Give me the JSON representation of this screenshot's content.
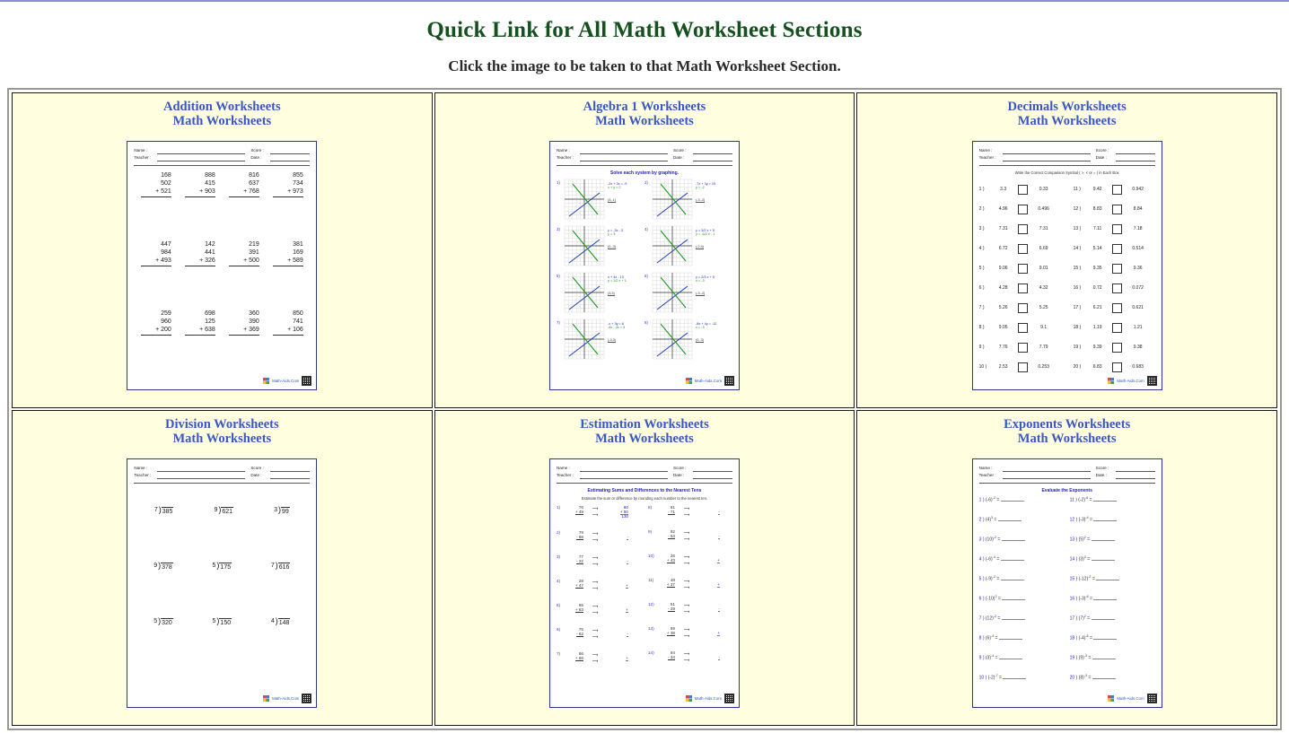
{
  "page": {
    "title": "Quick Link for All Math Worksheet Sections",
    "subtitle": "Click the image to be taken to that Math Worksheet Section.",
    "title_color": "#15501f",
    "link_color": "#3a57c4",
    "cell_bg": "#ffffe0"
  },
  "worksheet_header": {
    "name_label": "Name :",
    "teacher_label": "Teacher :",
    "score_label": "Score :",
    "date_label": "Date :"
  },
  "footer": {
    "logo": "math-aids-logo",
    "text": "Math-Aids.Com",
    "qr": "qr-code"
  },
  "cells": [
    {
      "id": "addition",
      "title_line1": "Addition Worksheets",
      "title_line2": "Math Worksheets",
      "sheet_type": "addition",
      "instruction": "",
      "rows": [
        [
          {
            "a": "168",
            "b": "502",
            "c": "+ 521"
          },
          {
            "a": "888",
            "b": "415",
            "c": "+ 903"
          },
          {
            "a": "816",
            "b": "637",
            "c": "+ 768"
          },
          {
            "a": "855",
            "b": "734",
            "c": "+ 973"
          }
        ],
        [
          {
            "a": "447",
            "b": "984",
            "c": "+ 493"
          },
          {
            "a": "142",
            "b": "441",
            "c": "+ 326"
          },
          {
            "a": "219",
            "b": "391",
            "c": "+ 500"
          },
          {
            "a": "381",
            "b": "169",
            "c": "+ 589"
          }
        ],
        [
          {
            "a": "259",
            "b": "960",
            "c": "+ 200"
          },
          {
            "a": "698",
            "b": "125",
            "c": "+ 638"
          },
          {
            "a": "360",
            "b": "390",
            "c": "+ 369"
          },
          {
            "a": "850",
            "b": "741",
            "c": "+ 106"
          }
        ]
      ]
    },
    {
      "id": "algebra-1",
      "title_line1": "Algebra 1 Worksheets",
      "title_line2": "Math Worksheets",
      "sheet_type": "algebra",
      "instruction": "Solve each system by graphing.",
      "problems": [
        {
          "no": "1)",
          "eq1": "-2x + 3x = -9",
          "eq2": "x + y = 2",
          "ans": "(3,-1)"
        },
        {
          "no": "2)",
          "eq1": "-7x + 3y = 15",
          "eq2": "y = -2",
          "ans": "(-3,-2)"
        },
        {
          "no": "3)",
          "eq1": "y = -3x - 3",
          "eq2": "y = 3",
          "ans": "(0,-3)"
        },
        {
          "no": "4)",
          "eq1": "y = 3/2 x + 5",
          "eq2": "y = -5/2 x - 1",
          "ans": "(-2,4)"
        },
        {
          "no": "5)",
          "eq1": "x + 4x - 13",
          "eq2": "y = 1/2 x + 1",
          "ans": "(3,3)"
        },
        {
          "no": "6)",
          "eq1": "y = 2/3 x + 5",
          "eq2": "x = -3",
          "ans": "(-3,-2)"
        },
        {
          "no": "7)",
          "eq1": "-x + 3y = 6",
          "eq2": "-5x - 3x = 3",
          "ans": "(-3,3)"
        },
        {
          "no": "8)",
          "eq1": "-8x + 4y = -12",
          "eq2": "x = -3",
          "ans": "(0,-3)"
        }
      ]
    },
    {
      "id": "decimals",
      "title_line1": "Decimals Worksheets",
      "title_line2": "Math Worksheets",
      "sheet_type": "decimals",
      "instruction": "Write the Correct Comparison Symbol ( >, < or = ) in Each Box",
      "left_items": [
        {
          "no": "1 )",
          "a": "3.3",
          "b": "0.33"
        },
        {
          "no": "2 )",
          "a": "4.96",
          "b": "0.496"
        },
        {
          "no": "3 )",
          "a": "7.31",
          "b": "7.31"
        },
        {
          "no": "4 )",
          "a": "6.72",
          "b": "6.69"
        },
        {
          "no": "5 )",
          "a": "9.06",
          "b": "9.01"
        },
        {
          "no": "6 )",
          "a": "4.28",
          "b": "4.32"
        },
        {
          "no": "7 )",
          "a": "5.26",
          "b": "5.25"
        },
        {
          "no": "8 )",
          "a": "9.05",
          "b": "9.1"
        },
        {
          "no": "9 )",
          "a": "7.76",
          "b": "7.79"
        },
        {
          "no": "10 )",
          "a": "2.53",
          "b": "0.253"
        }
      ],
      "right_items": [
        {
          "no": "11 )",
          "a": "9.42",
          "b": "0.942"
        },
        {
          "no": "12 )",
          "a": "8.83",
          "b": "8.84"
        },
        {
          "no": "13 )",
          "a": "7.11",
          "b": "7.18"
        },
        {
          "no": "14 )",
          "a": "5.14",
          "b": "0.514"
        },
        {
          "no": "15 )",
          "a": "9.35",
          "b": "9.36"
        },
        {
          "no": "16 )",
          "a": "0.72",
          "b": "0.072"
        },
        {
          "no": "17 )",
          "a": "6.21",
          "b": "0.621"
        },
        {
          "no": "18 )",
          "a": "1.19",
          "b": "1.21"
        },
        {
          "no": "19 )",
          "a": "9.39",
          "b": "9.38"
        },
        {
          "no": "20 )",
          "a": "6.83",
          "b": "0.683"
        }
      ]
    },
    {
      "id": "division",
      "title_line1": "Division Worksheets",
      "title_line2": "Math Worksheets",
      "sheet_type": "division",
      "instruction": "",
      "rows": [
        [
          {
            "divisor": "7",
            "dividend": "385"
          },
          {
            "divisor": "9",
            "dividend": "621"
          },
          {
            "divisor": "3",
            "dividend": "99"
          }
        ],
        [
          {
            "divisor": "9",
            "dividend": "378"
          },
          {
            "divisor": "5",
            "dividend": "175"
          },
          {
            "divisor": "7",
            "dividend": "616"
          }
        ],
        [
          {
            "divisor": "5",
            "dividend": "320"
          },
          {
            "divisor": "5",
            "dividend": "150"
          },
          {
            "divisor": "4",
            "dividend": "148"
          }
        ]
      ]
    },
    {
      "id": "estimation",
      "title_line1": "Estimation Worksheets",
      "title_line2": "Math Worksheets",
      "sheet_type": "estimation",
      "instruction": "Estimating Sums and Differences to the Nearest Tens",
      "instruction2": "Estimate the sum or difference by rounding each number to the nearest ten.",
      "left_items": [
        {
          "no": "1)",
          "top": "76",
          "bottom": "+ 49",
          "rtop": "80",
          "rbottom": "+ 50",
          "total": "130"
        },
        {
          "no": "2)",
          "top": "79",
          "bottom": "- 68",
          "rtop": "",
          "rbottom": "-",
          "total": ""
        },
        {
          "no": "3)",
          "top": "77",
          "bottom": "- 22",
          "rtop": "",
          "rbottom": "-",
          "total": ""
        },
        {
          "no": "4)",
          "top": "28",
          "bottom": "+ 47",
          "rtop": "",
          "rbottom": "+",
          "total": ""
        },
        {
          "no": "5)",
          "top": "65",
          "bottom": "+ 63",
          "rtop": "",
          "rbottom": "+",
          "total": ""
        },
        {
          "no": "6)",
          "top": "75",
          "bottom": "- 62",
          "rtop": "",
          "rbottom": "-",
          "total": ""
        },
        {
          "no": "7)",
          "top": "66",
          "bottom": "+ 86",
          "rtop": "",
          "rbottom": "+",
          "total": ""
        }
      ],
      "right_items": [
        {
          "no": "8)",
          "top": "81",
          "bottom": "- 71",
          "rtop": "",
          "rbottom": "-",
          "total": ""
        },
        {
          "no": "9)",
          "top": "92",
          "bottom": "- 54",
          "rtop": "",
          "rbottom": "-",
          "total": ""
        },
        {
          "no": "10)",
          "top": "26",
          "bottom": "+ 43",
          "rtop": "",
          "rbottom": "+",
          "total": ""
        },
        {
          "no": "11)",
          "top": "48",
          "bottom": "+ 37",
          "rtop": "",
          "rbottom": "+",
          "total": ""
        },
        {
          "no": "12)",
          "top": "51",
          "bottom": "- 29",
          "rtop": "",
          "rbottom": "-",
          "total": ""
        },
        {
          "no": "13)",
          "top": "69",
          "bottom": "+ 38",
          "rtop": "",
          "rbottom": "+",
          "total": ""
        },
        {
          "no": "14)",
          "top": "94",
          "bottom": "- 34",
          "rtop": "",
          "rbottom": "-",
          "total": ""
        }
      ]
    },
    {
      "id": "exponents",
      "title_line1": "Exponents Worksheets",
      "title_line2": "Math Worksheets",
      "sheet_type": "exponents",
      "instruction": "Evaluate the Exponents",
      "left_items": [
        {
          "no": "1 )",
          "base": "(-6)",
          "exp": "-2"
        },
        {
          "no": "2 )",
          "base": "(4)",
          "exp": "3"
        },
        {
          "no": "3 )",
          "base": "(10)",
          "exp": "-2"
        },
        {
          "no": "4 )",
          "base": "(-6)",
          "exp": "-4"
        },
        {
          "no": "5 )",
          "base": "(-9)",
          "exp": "-2"
        },
        {
          "no": "6 )",
          "base": "(-10)",
          "exp": "3"
        },
        {
          "no": "7 )",
          "base": "(12)",
          "exp": "-2"
        },
        {
          "no": "8 )",
          "base": "(6)",
          "exp": "-4"
        },
        {
          "no": "9 )",
          "base": "(3)",
          "exp": "-4"
        },
        {
          "no": "10 )",
          "base": "(-2)",
          "exp": "-7"
        }
      ],
      "right_items": [
        {
          "no": "11 )",
          "base": "(-2)",
          "exp": "-6"
        },
        {
          "no": "12 )",
          "base": "(-3)",
          "exp": "-4"
        },
        {
          "no": "13 )",
          "base": "(5)",
          "exp": "2"
        },
        {
          "no": "14 )",
          "base": "(3)",
          "exp": "3"
        },
        {
          "no": "15 )",
          "base": "(-12)",
          "exp": "-2"
        },
        {
          "no": "16 )",
          "base": "(-3)",
          "exp": "-6"
        },
        {
          "no": "17 )",
          "base": "(7)",
          "exp": "2"
        },
        {
          "no": "18 )",
          "base": "(-4)",
          "exp": "-6"
        },
        {
          "no": "19 )",
          "base": "(9)",
          "exp": "-3"
        },
        {
          "no": "20 )",
          "base": "(8)",
          "exp": "-3"
        }
      ]
    }
  ]
}
